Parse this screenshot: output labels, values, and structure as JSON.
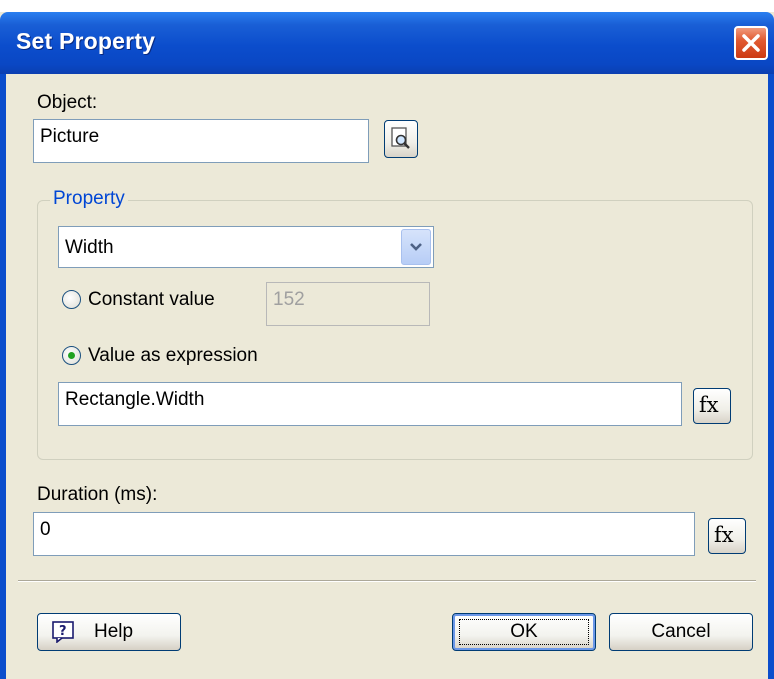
{
  "window": {
    "title": "Set Property"
  },
  "object": {
    "label": "Object:",
    "value": "Picture"
  },
  "property": {
    "group_label": "Property",
    "selected": "Width",
    "constant_label": "Constant value",
    "constant_value": "152",
    "expression_label": "Value as expression",
    "expression_value": "Rectangle.Width",
    "mode": "expression"
  },
  "duration": {
    "label": "Duration (ms):",
    "value": "0"
  },
  "buttons": {
    "help": "Help",
    "ok": "OK",
    "cancel": "Cancel",
    "fx": "fx"
  },
  "colors": {
    "titlebar": "#0b4dcc",
    "accent_label": "#0046d5",
    "close": "#e15b33",
    "radio_dot": "#21a121"
  },
  "icons": {
    "browse": "magnifier-icon",
    "help": "question-icon",
    "close": "close-icon"
  }
}
